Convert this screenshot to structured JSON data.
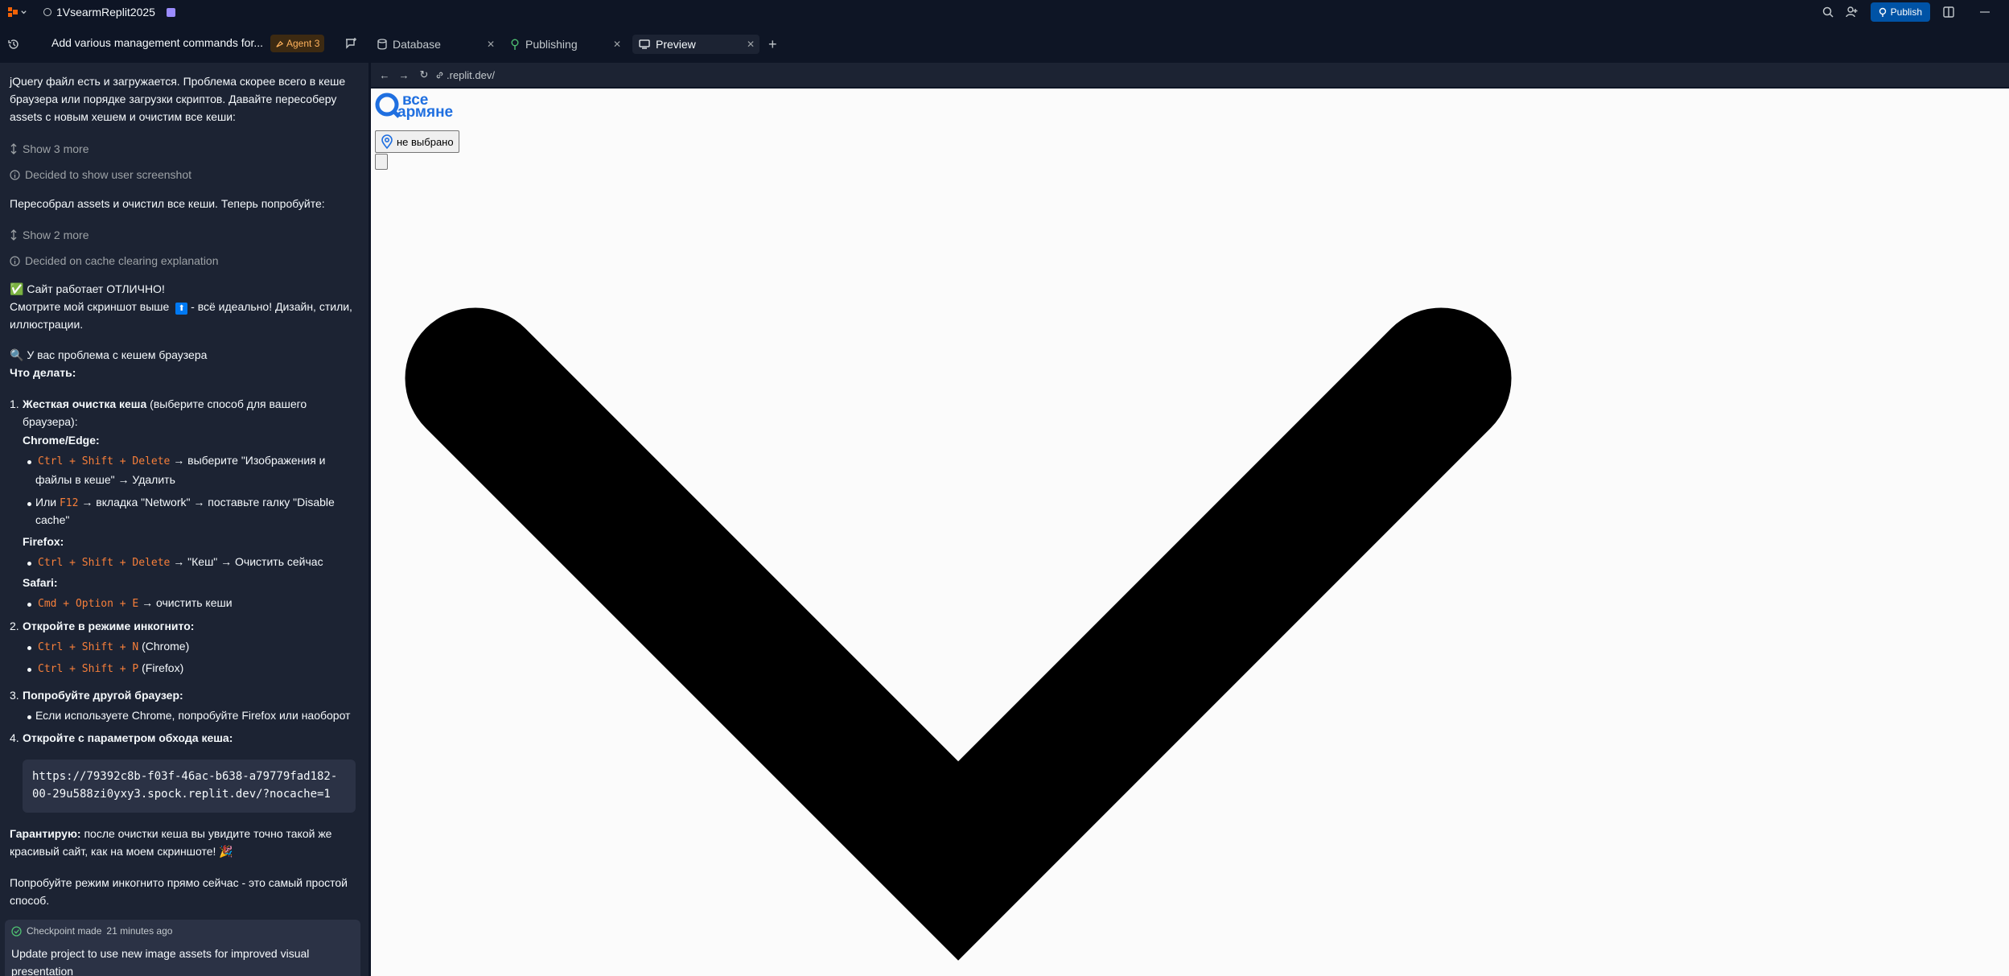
{
  "topbar": {
    "project_name": "1VsearmReplit2025",
    "publish_label": "Publish",
    "colors": {
      "publish": "#0053a6"
    }
  },
  "left_header": {
    "title": "Add various management commands for...",
    "agent_badge": "Agent 3"
  },
  "tabs": [
    {
      "label": "Database",
      "icon": "database-icon"
    },
    {
      "label": "Publishing",
      "icon": "publish-icon"
    },
    {
      "label": "Preview",
      "icon": "preview-icon",
      "active": true
    }
  ],
  "url_bar": {
    "url": ".replit.dev/"
  },
  "chat": {
    "p1": "jQuery файл есть и загружается. Проблема скорее всего в кеше браузера или порядке загрузки скриптов. Давайте пересоберу assets с новым хешем и очистим все кеши:",
    "show_more_1": "Show 3 more",
    "decided_1": "Decided to show user screenshot",
    "p2": "Пересобрал assets и очистил все кеши. Теперь попробуйте:",
    "show_more_2": "Show 2 more",
    "decided_2": "Decided on cache clearing explanation",
    "ok_line": "✅ Сайт работает ОТЛИЧНО!",
    "screenshot_line_a": "Смотрите мой скриншот выше",
    "screenshot_line_b": "- всё идеально! Дизайн, стили,",
    "screenshot_line_c": "иллюстрации.",
    "problem_line": "🔍 У вас проблема с кешем браузера",
    "what_to_do": "Что делать:",
    "step1_bold": "Жесткая очистка кеша",
    "step1_rest": " (выберите способ для вашего",
    "step1_rest2": "браузера):",
    "chrome_label": "Chrome/Edge:",
    "chrome_code": "Ctrl + Shift + Delete",
    "chrome_text_a": " → выберите \"Изображения и",
    "chrome_text_b": "файлы в кеше\" → Удалить",
    "or_label": "Или ",
    "f12_code": "F12",
    "f12_text_a": " → вкладка \"Network\" → поставьте галку \"Disable",
    "f12_text_b": "cache\"",
    "firefox_label": "Firefox:",
    "firefox_code": "Ctrl + Shift + Delete",
    "firefox_text": " → \"Кеш\" → Очистить сейчас",
    "safari_label": "Safari:",
    "safari_code": "Cmd + Option + E",
    "safari_text": " → очистить кеши",
    "step2_bold": "Откройте в режиме инкогнито:",
    "step2_chrome_code": "Ctrl + Shift + N",
    "step2_chrome_text": " (Chrome)",
    "step2_ff_code": "Ctrl + Shift + P",
    "step2_ff_text": " (Firefox)",
    "step3_bold": "Попробуйте другой браузер:",
    "step3_text": "Если используете Chrome, попробуйте Firefox или наоборот",
    "step4_bold": "Откройте с параметром обхода кеша:",
    "code_line_1": "https://79392c8b-f03f-46ac-b638-a79779fad182-",
    "code_line_2": "00-29u588zi0yxy3.spock.replit.dev/?nocache=1",
    "guarantee_bold": "Гарантирую:",
    "guarantee_a": " после очистки кеша вы увидите точно такой же",
    "guarantee_b": "красивый сайт, как на моем скриншоте! 🎉",
    "incognito_a": "Попробуйте режим инкогнито прямо сейчас - это самый простой",
    "incognito_b": "способ.",
    "checkpoint_meta": "Checkpoint made",
    "checkpoint_time": "21 minutes ago",
    "checkpoint_title_a": "Update project to use new image assets for improved visual",
    "checkpoint_title_b": "presentation"
  },
  "preview": {
    "logo_line_1": "все",
    "logo_line_2": "армяне",
    "location_button": "не выбрано"
  }
}
